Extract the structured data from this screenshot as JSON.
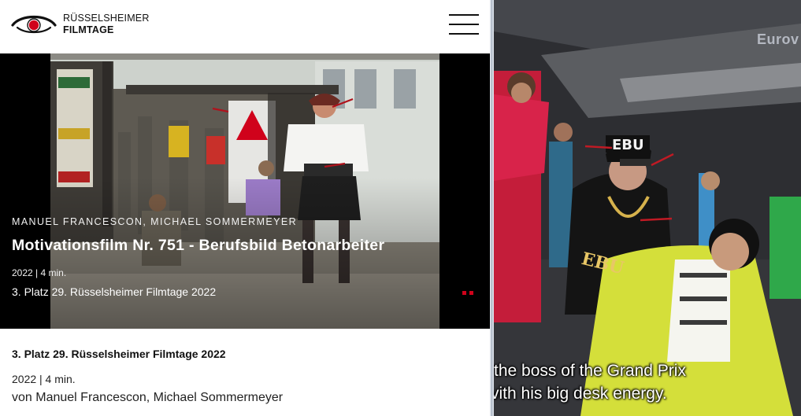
{
  "site": {
    "logo": {
      "line1": "RÜSSELSHEIMER",
      "line2": "FILMTAGE",
      "icon": "eye-logo-icon"
    },
    "menu": {
      "icon": "hamburger-menu-icon"
    }
  },
  "hero": {
    "authors": "MANUEL FRANCESCON, MICHAEL SOMMERMEYER",
    "title": "Motivationsfilm Nr. 751 - Berufsbild Betonarbeiter",
    "meta": "2022 | 4 min.",
    "award": "3. Platz 29. Rüsselsheimer Filmtage 2022",
    "slider": {
      "dots": 2,
      "active_color": "#d0021b"
    }
  },
  "details": {
    "award": "3. Platz 29. Rüsselsheimer Filmtage 2022",
    "meta": "2022 | 4 min.",
    "authors": "von Manuel Francescon, Michael Sommermeyer"
  },
  "video": {
    "channel_logo": "Eurov",
    "subtitles": [
      "the boss of the Grand Prix",
      "vith his big desk energy."
    ],
    "cap_text": "EBU",
    "necklace_text": "EBU"
  },
  "colors": {
    "brand_red": "#d0021b",
    "text_dark": "#111111",
    "hero_bg": "#000000",
    "jacket_yellow": "#d4df3a"
  }
}
